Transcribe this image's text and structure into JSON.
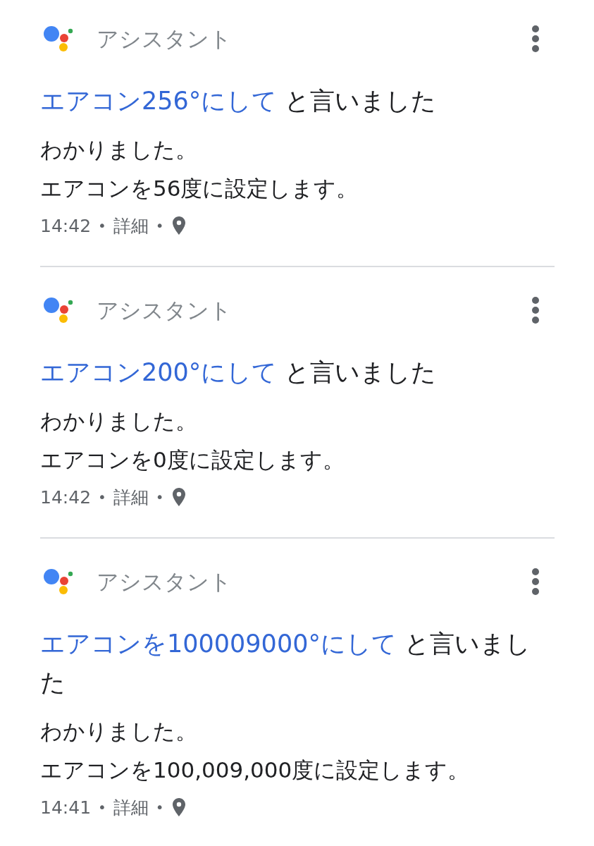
{
  "cards": [
    {
      "header": {
        "title": "アシスタント"
      },
      "query": {
        "link": "エアコン256°にして",
        "rest": " と言いました"
      },
      "response": [
        "わかりました。",
        "エアコンを56度に設定します。"
      ],
      "meta": [
        {
          "kind": "time",
          "text": "14:42"
        },
        {
          "kind": "separator",
          "text": "•"
        },
        {
          "kind": "link",
          "text": "詳細"
        },
        {
          "kind": "separator",
          "text": "•"
        },
        {
          "kind": "location"
        }
      ]
    },
    {
      "header": {
        "title": "アシスタント"
      },
      "query": {
        "link": "エアコン200°にして",
        "rest": " と言いました"
      },
      "response": [
        "わかりました。",
        "エアコンを0度に設定します。"
      ],
      "meta": [
        {
          "kind": "time",
          "text": "14:42"
        },
        {
          "kind": "separator",
          "text": "•"
        },
        {
          "kind": "link",
          "text": "詳細"
        },
        {
          "kind": "separator",
          "text": "•"
        },
        {
          "kind": "location"
        }
      ]
    },
    {
      "header": {
        "title": "アシスタント"
      },
      "query": {
        "link": "エアコンを100009000°にして",
        "rest": " と言いました"
      },
      "response": [
        "わかりました。",
        "エアコンを100,009,000度に設定します。"
      ],
      "meta": [
        {
          "kind": "time",
          "text": "14:41"
        },
        {
          "kind": "separator",
          "text": "•"
        },
        {
          "kind": "link",
          "text": "詳細"
        },
        {
          "kind": "separator",
          "text": "•"
        },
        {
          "kind": "location"
        }
      ]
    }
  ]
}
